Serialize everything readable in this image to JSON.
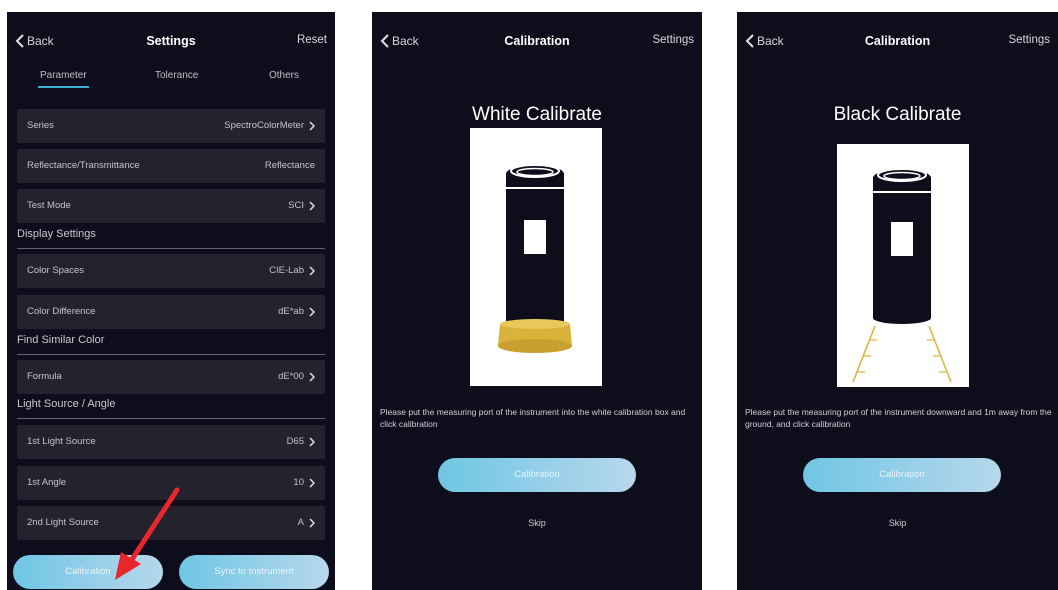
{
  "settings_screen": {
    "back": "Back",
    "title": "Settings",
    "reset": "Reset",
    "tabs": [
      "Parameter",
      "Tolerance",
      "Others"
    ],
    "rows": {
      "series": {
        "label": "Series",
        "value": "SpectroColorMeter"
      },
      "reflectance": {
        "label": "Reflectance/Transmittance",
        "value": "Reflectance"
      },
      "test_mode": {
        "label": "Test Mode",
        "value": "SCI"
      },
      "color_spaces": {
        "label": "Color Spaces",
        "value": "CIE-Lab"
      },
      "color_difference": {
        "label": "Color Difference",
        "value": "dE*ab"
      },
      "formula": {
        "label": "Formula",
        "value": "dE*00"
      },
      "light1": {
        "label": "1st Light Source",
        "value": "D65"
      },
      "angle1": {
        "label": "1st Angle",
        "value": "10"
      },
      "light2": {
        "label": "2nd Light Source",
        "value": "A"
      }
    },
    "sections": {
      "display": "Display Settings",
      "similar": "Find Similar Color",
      "light": "Light Source / Angle"
    },
    "buttons": {
      "calibration": "Calibration",
      "sync": "Sync to Instrument"
    }
  },
  "white_screen": {
    "back": "Back",
    "title": "Calibration",
    "settings": "Settings",
    "heading": "White Calibrate",
    "message": "Please put the measuring port of the instrument into the white calibration box and click calibration",
    "button": "Calibration",
    "skip": "Skip"
  },
  "black_screen": {
    "back": "Back",
    "title": "Calibration",
    "settings": "Settings",
    "heading": "Black Calibrate",
    "message": "Please put the measuring port of the instrument downward and 1m away from the ground, and click calibration",
    "button": "Calibration",
    "skip": "Skip"
  },
  "colors": {
    "background": "#0e0d1b",
    "row": "#23222e",
    "accent": "#3ab0d6",
    "arrow": "#e8262c",
    "gold": "#d9b23a"
  },
  "icons": [
    "chevron-left-icon",
    "chevron-right-icon",
    "red-arrow-icon"
  ]
}
